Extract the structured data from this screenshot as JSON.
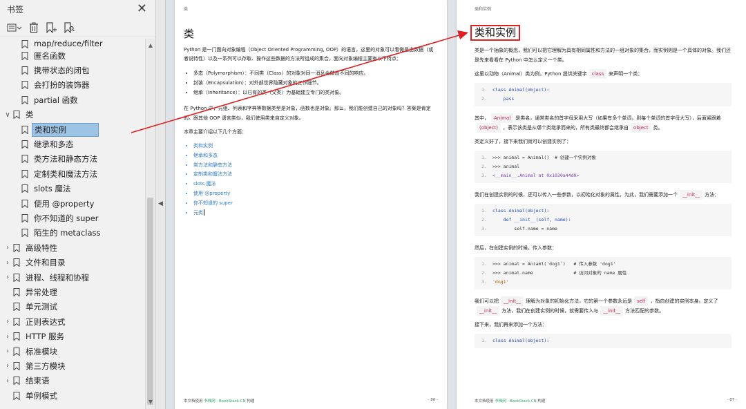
{
  "sidebar": {
    "title": "书签",
    "close_icon": "close-icon",
    "tools": [
      "outline-options-icon",
      "delete-bookmark-icon",
      "add-bookmark-icon",
      "find-bookmark-icon"
    ],
    "items": [
      {
        "label": "map/reduce/filter",
        "level": 2,
        "expandable": false
      },
      {
        "label": "匿名函数",
        "level": 2,
        "expandable": false
      },
      {
        "label": "携带状态的闭包",
        "level": 2,
        "expandable": false
      },
      {
        "label": "会打扮的装饰器",
        "level": 2,
        "expandable": false
      },
      {
        "label": "partial 函数",
        "level": 2,
        "expandable": false
      },
      {
        "label": "类",
        "level": 1,
        "expandable": true,
        "expanded": true
      },
      {
        "label": "类和实例",
        "level": 2,
        "expandable": false,
        "selected": true
      },
      {
        "label": "继承和多态",
        "level": 2,
        "expandable": false
      },
      {
        "label": "类方法和静态方法",
        "level": 2,
        "expandable": false
      },
      {
        "label": "定制类和魔法方法",
        "level": 2,
        "expandable": false
      },
      {
        "label": "slots 魔法",
        "level": 2,
        "expandable": false
      },
      {
        "label": "使用 @property",
        "level": 2,
        "expandable": false
      },
      {
        "label": "你不知道的 super",
        "level": 2,
        "expandable": false
      },
      {
        "label": "陌生的 metaclass",
        "level": 2,
        "expandable": false
      },
      {
        "label": "高级特性",
        "level": 1,
        "expandable": true
      },
      {
        "label": "文件和目录",
        "level": 1,
        "expandable": true
      },
      {
        "label": "进程、线程和协程",
        "level": 1,
        "expandable": true
      },
      {
        "label": "异常处理",
        "level": 1,
        "expandable": false
      },
      {
        "label": "单元测试",
        "level": 1,
        "expandable": false
      },
      {
        "label": "正则表达式",
        "level": 1,
        "expandable": true
      },
      {
        "label": "HTTP 服务",
        "level": 1,
        "expandable": true
      },
      {
        "label": "标准模块",
        "level": 1,
        "expandable": true
      },
      {
        "label": "第三方模块",
        "level": 1,
        "expandable": true
      },
      {
        "label": "结束语",
        "level": 1,
        "expandable": true
      },
      {
        "label": "单例模式",
        "level": 1,
        "expandable": false
      }
    ]
  },
  "page1": {
    "running_head": "类",
    "heading": "类",
    "intro": "Python 是一门面向对象编程（Object Oriented Programming, OOP）的语言，这里的对象可以看做是由数据（或者说特性）以及一系列可以存取、操作这些数据的方法所组成的集合。面向对象编程主要有以下特点：",
    "features": [
      "多态（Polymorphism）：不同类（Class）的对象对同一消息会做出不同的响应。",
      "封装（Encapsulation）：对外部世界隐藏对象的工作细节。",
      "继承（Inheritance）：以已有的类（父类）为基础建立专门的类对象。"
    ],
    "para2": "在 Python 中，元组、列表和字典等数据类型是对象，函数也是对象。那么，我们能创建自己的对象吗？答案是肯定的。跟其他 OOP 语言类似，我们使用类来自定义对象。",
    "para3": "本章主要介绍以下几个方面：",
    "links": [
      "类和实例",
      "继承和多态",
      "类方法和静态方法",
      "定制类和魔法方法",
      "slots 魔法",
      "使用 @property",
      "你不知道的 super",
      "元类"
    ],
    "footer_left": "本文档使用",
    "footer_brand": "书栈网 · BookStack.CN",
    "footer_suffix": "构建",
    "page_no": "- 86 -"
  },
  "page2": {
    "running_head": "类和实例",
    "heading": "类和实例",
    "p1": "类是一个抽象的概念，我们可以把它理解为具有相同属性和方法的一组对象的集合，而实例则是一个具体的对象。我们还是先来看看在 Python 中怎么定义一个类。",
    "p2a": "这里以动物（Animal）类为例，Python 提供关键字",
    "p2code": "class",
    "p2b": "来声明一个类：",
    "code1": [
      "class Animal(object):",
      "    pass"
    ],
    "p3a": "其中，",
    "p3code1": "Animal",
    "p3b": "是类名，通常类名的首字母采用大写（如果有多个单词，则每个单词的首字母大写），后面紧跟着",
    "p3code2": "(object)",
    "p3c": "，表示该类是从哪个类继承而来的，所有类最终都会继承自",
    "p3code3": "object",
    "p3d": "类。",
    "p4": "类定义好了，接下来我们就可以创建实例了：",
    "code2": [
      ">>> animal = Animal()  # 创建一个实例对象",
      ">>> animal",
      "<__main__.Animal at 0x1030a44d0>"
    ],
    "p5a": "我们在创建实例的时候，还可以传入一些参数，以初始化对象的属性，为此，我们需要添加一个",
    "p5code": "__init__",
    "p5b": "方法：",
    "code3": [
      "class Animal(object):",
      "    def __init__(self, name):",
      "        self.name = name"
    ],
    "p6": "然后，在创建实例的时候，传入参数：",
    "code4": [
      ">>> animal = Aniaml('dog1')   # 传入参数 'dog1'",
      ">>> animal.name               # 访问对象的 name 属性",
      "'dog1'"
    ],
    "p7a": "我们可以把",
    "p7code1": "__init__",
    "p7b": "理解为对象的初始化方法，它的第一个参数永远是",
    "p7code2": "self",
    "p7c": "，指向创建的实例本身。定义了",
    "p7code3": "__init__",
    "p7d": "方法，我们在创建实例的时候，就需要传入与",
    "p7code4": "__init__",
    "p7e": "方法匹配的参数。",
    "p8": "接下来，我们再来添加一个方法：",
    "code5": [
      "class Animal(object):"
    ],
    "footer_left": "本文档使用",
    "footer_brand": "书栈网 · BookStack.CN",
    "footer_suffix": "构建",
    "page_no": "- 87 -"
  },
  "colors": {
    "selection": "#9ec4e4",
    "annotation_red": "#e02020",
    "link_blue": "#2f7bc4",
    "code_red": "#c7254e"
  }
}
